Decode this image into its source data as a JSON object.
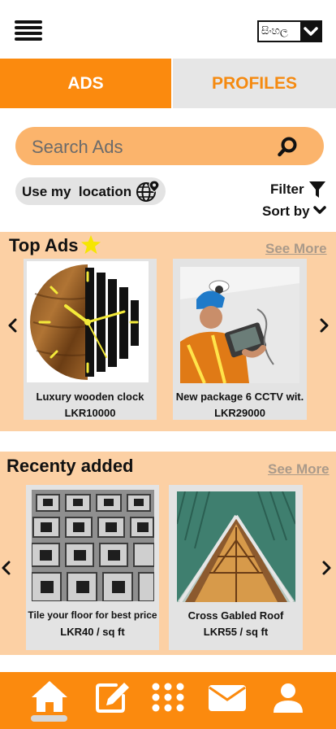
{
  "header": {
    "menu_icon": "hamburger-menu-icon",
    "language_label": "සිංහල",
    "language_chevron_icon": "chevron-down-icon"
  },
  "tabs": [
    {
      "label": "ADS",
      "active": true
    },
    {
      "label": "PROFILES",
      "active": false
    }
  ],
  "search": {
    "placeholder": "Search Ads",
    "icon": "search-icon"
  },
  "location": {
    "label": "Use my  location",
    "icon": "globe-pin-icon"
  },
  "filter": {
    "label": "Filter",
    "icon": "funnel-icon"
  },
  "sort": {
    "label": "Sort by",
    "icon": "chevron-down-icon"
  },
  "top_ads": {
    "title": "Top Ads",
    "title_icon": "star-icon",
    "see_more": "See More",
    "items": [
      {
        "name": "Luxury wooden clock",
        "price": "LKR10000"
      },
      {
        "name": "New package 6 CCTV wit.",
        "price": "LKR29000"
      }
    ]
  },
  "recent": {
    "title": "Recenty added",
    "see_more": "See More",
    "items": [
      {
        "name": "Tile your floor for best price",
        "price": "LKR40 / sq ft"
      },
      {
        "name": "Cross Gabled Roof",
        "price": "LKR55 / sq ft"
      }
    ]
  },
  "bottom_nav": [
    {
      "icon": "home-icon",
      "active": true
    },
    {
      "icon": "edit-icon",
      "active": false
    },
    {
      "icon": "grid-icon",
      "active": false
    },
    {
      "icon": "mail-icon",
      "active": false
    },
    {
      "icon": "user-icon",
      "active": false
    }
  ],
  "colors": {
    "accent": "#fb8a0e",
    "search_bg": "#fbb46c",
    "section_bg": "#fcd0a4",
    "card_bg": "#e3e3e3"
  }
}
